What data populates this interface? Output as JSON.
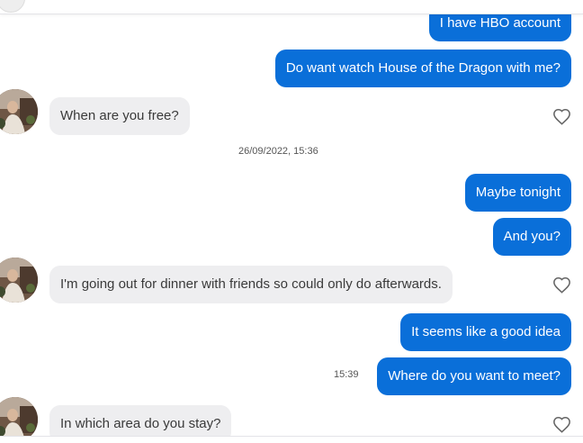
{
  "messages": [
    {
      "text": "I have HBO account"
    },
    {
      "text": "Do want watch House of the Dragon with me?"
    },
    {
      "text": "When are you free?"
    },
    {
      "text": "Maybe tonight"
    },
    {
      "text": "And you?"
    },
    {
      "text": "I'm going out for dinner with friends so could only do afterwards."
    },
    {
      "text": "It seems like a good idea"
    },
    {
      "text": "Where do you want to meet?"
    },
    {
      "text": "In which area do you stay?"
    }
  ],
  "date_separator": "26/09/2022, 15:36",
  "time_label": "15:39",
  "icons": {
    "like": "heart-icon",
    "avatar": "user-avatar"
  },
  "colors": {
    "outgoing_bubble": "#0a6fd9",
    "incoming_bubble": "#eeeef0"
  }
}
